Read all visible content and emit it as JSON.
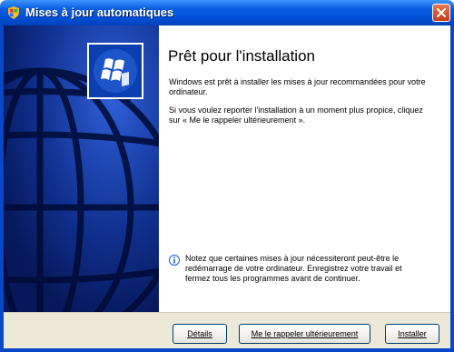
{
  "window": {
    "title": "Mises à jour automatiques",
    "icons": {
      "title": "windows-update-shield-icon",
      "close": "close-icon",
      "logo": "windows-logo-icon",
      "info": "info-icon"
    },
    "colors": {
      "title_bar": "#0a5ddf",
      "side_panel": "#0b2a88",
      "close": "#d2472a",
      "footer": "#ece9d8"
    }
  },
  "content": {
    "heading": "Prêt pour l'installation",
    "paragraph1": "Windows est prêt à installer les mises à jour recommandées pour votre ordinateur.",
    "paragraph2": "Si vous voulez reporter l'installation à un moment plus propice, cliquez sur « Me le rappeler ultérieurement ».",
    "notice": "Notez que certaines mises à jour nécessiteront peut-être le redémarrage de votre ordinateur. Enregistrez votre travail et fermez tous les programmes avant de continuer."
  },
  "buttons": {
    "details": "Détails",
    "remind_later": "Me le rappeler ultérieurement",
    "install": "Installer"
  }
}
